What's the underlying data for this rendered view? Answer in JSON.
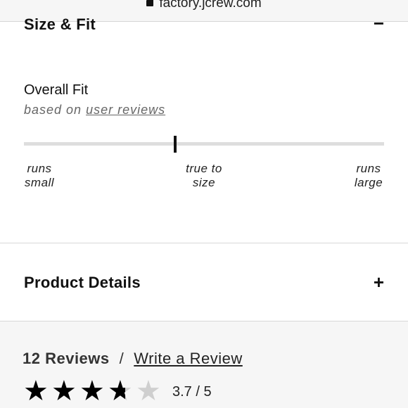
{
  "browser": {
    "url": "factory.jcrew.com"
  },
  "size_fit": {
    "title": "Size & Fit",
    "toggle": "−",
    "overall_fit_title": "Overall Fit",
    "based_on": "based on",
    "user_reviews_link": "user reviews",
    "fit_level": 0.42,
    "scale": {
      "left_line1": "runs",
      "left_line2": "small",
      "mid_line1": "true to",
      "mid_line2": "size",
      "right_line1": "runs",
      "right_line2": "large"
    }
  },
  "product_details": {
    "title": "Product Details",
    "toggle": "+"
  },
  "reviews": {
    "count_label": "12 Reviews",
    "separator": "/",
    "write_link": "Write a Review",
    "rating": 3.7,
    "max_rating": 5,
    "rating_text": "3.7 / 5"
  }
}
